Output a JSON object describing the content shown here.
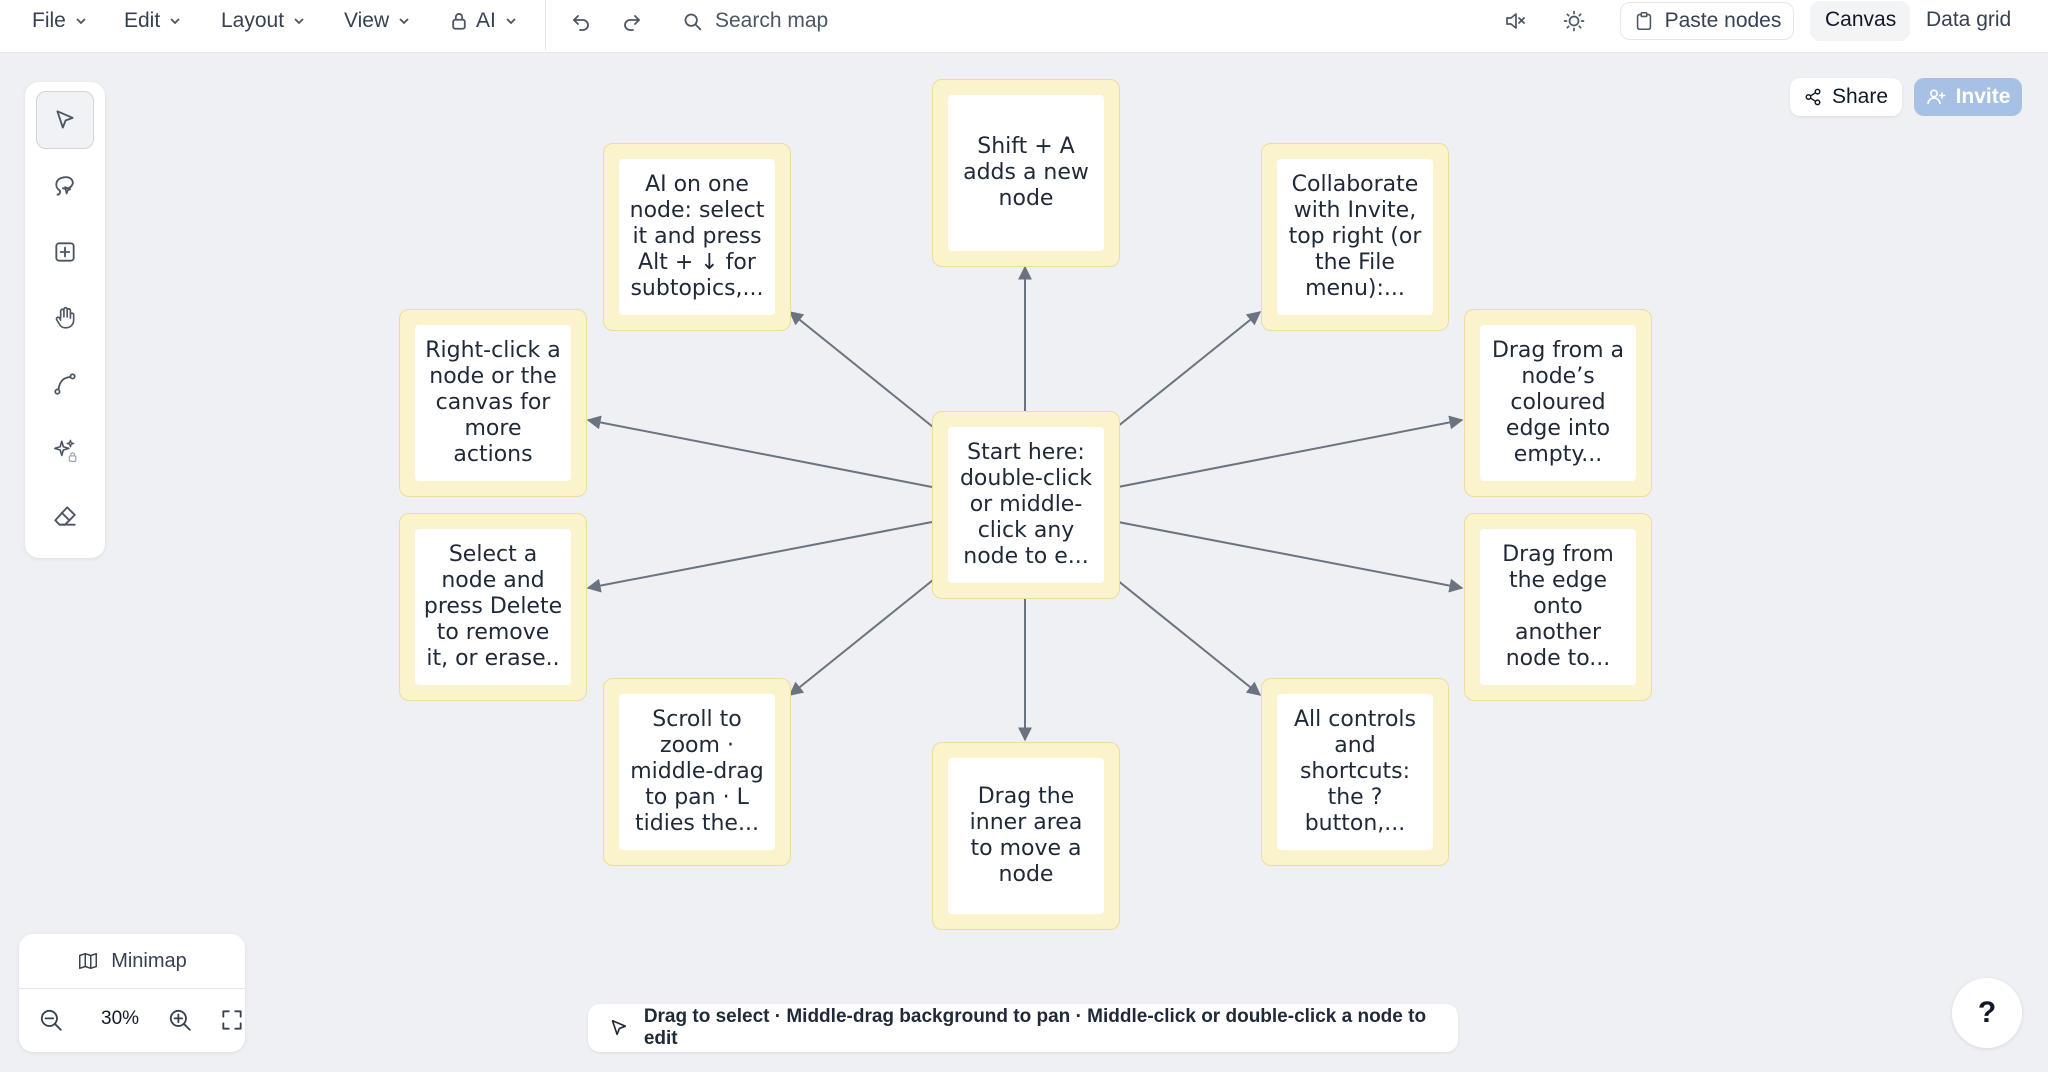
{
  "menubar": {
    "menus": [
      {
        "label": "File",
        "icon": "chevron-down-icon"
      },
      {
        "label": "Edit",
        "icon": "chevron-down-icon"
      },
      {
        "label": "Layout",
        "icon": "chevron-down-icon"
      },
      {
        "label": "View",
        "icon": "chevron-down-icon"
      },
      {
        "label": "AI",
        "icon": "lock-icon"
      }
    ],
    "search_placeholder": "Search map",
    "paste_label": "Paste nodes",
    "tabs": [
      {
        "label": "Canvas",
        "active": true
      },
      {
        "label": "Data grid",
        "active": false
      }
    ]
  },
  "toolbar": {
    "tools": [
      {
        "name": "select-tool",
        "icon": "cursor-arrow-icon",
        "active": true
      },
      {
        "name": "lasso-tool",
        "icon": "lasso-icon",
        "active": false
      },
      {
        "name": "add-node-tool",
        "icon": "plus-square-icon",
        "active": false
      },
      {
        "name": "pan-tool",
        "icon": "hand-icon",
        "active": false
      },
      {
        "name": "connector-tool",
        "icon": "curve-icon",
        "active": false
      },
      {
        "name": "ai-tool",
        "icon": "sparkles-lock-icon",
        "active": false
      },
      {
        "name": "eraser-tool",
        "icon": "eraser-icon",
        "active": false
      }
    ]
  },
  "actions": {
    "share_label": "Share",
    "invite_label": "Invite"
  },
  "nodes": {
    "center": "Start here: double-click or middle-click any node to e...",
    "top": "Shift + A adds a new node",
    "top_left": "AI on one node: select it and press Alt + ↓ for subtopics,...",
    "top_right": "Collaborate with Invite, top right (or the File menu):...",
    "left_upper": "Right-click a node or the canvas for more actions",
    "right_upper": "Drag from a node’s coloured edge into empty...",
    "left_lower": "Select a node and press Delete to remove it, or erase..",
    "right_lower": "Drag from the edge onto another node to...",
    "bottom_left": "Scroll to zoom · middle-drag to pan · L tidies the...",
    "bottom_right": "All controls and shortcuts: the ? button,...",
    "bottom": "Drag the inner area to move a node"
  },
  "minimap": {
    "label": "Minimap",
    "zoom_level": "30%"
  },
  "status_hint": "Drag to select · Middle-drag background to pan · Middle-click or double-click a node to edit",
  "help_label": "?",
  "colors": {
    "node_border": "#eadd9e",
    "node_fill": "#fbf3cc",
    "edge": "#6b7280",
    "invite": "#a7c1e4",
    "canvas": "#eef0f3"
  }
}
